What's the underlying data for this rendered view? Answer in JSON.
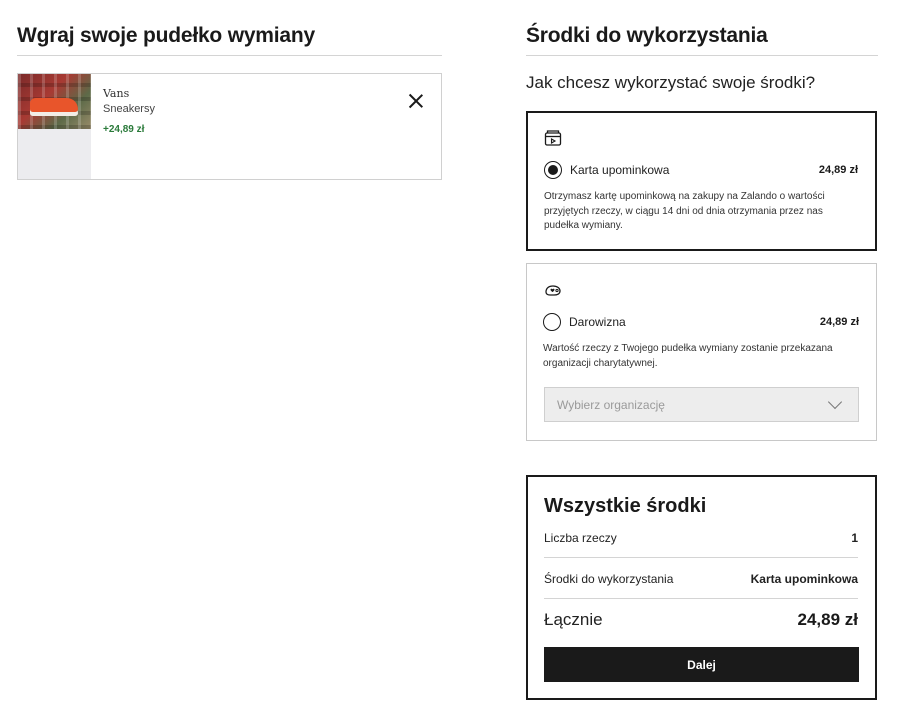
{
  "left": {
    "title": "Wgraj swoje pudełko wymiany",
    "item": {
      "brand": "Vans",
      "category": "Sneakersy",
      "credit": "+24,89 zł",
      "remove_icon": "close-icon"
    }
  },
  "right": {
    "title": "Środki do wykorzystania",
    "question": "Jak chcesz wykorzystać swoje środki?",
    "options": [
      {
        "icon": "gift-card-icon",
        "label": "Karta upominkowa",
        "amount": "24,89 zł",
        "selected": true,
        "description": "Otrzymasz kartę upominkową na zakupy na Zalando o wartości przyjętych rzeczy, w ciągu 14 dni od dnia otrzymania przez nas pudełka wymiany."
      },
      {
        "icon": "donation-icon",
        "label": "Darowizna",
        "amount": "24,89 zł",
        "selected": false,
        "description": "Wartość rzeczy z Twojego pudełka wymiany zostanie przekazana organizacji charytatywnej.",
        "select_placeholder": "Wybierz organizację"
      }
    ],
    "summary": {
      "title": "Wszystkie środki",
      "rows": [
        {
          "label": "Liczba rzeczy",
          "value": "1"
        },
        {
          "label": "Środki do wykorzystania",
          "value": "Karta upominkowa"
        }
      ],
      "total_label": "Łącznie",
      "total_value": "24,89 zł",
      "button_label": "Dalej"
    }
  },
  "colors": {
    "text": "#1a1a1a",
    "credit_green": "#2a7a3a",
    "button_bg": "#1a1a1a",
    "border_light": "#d0d0d0"
  }
}
